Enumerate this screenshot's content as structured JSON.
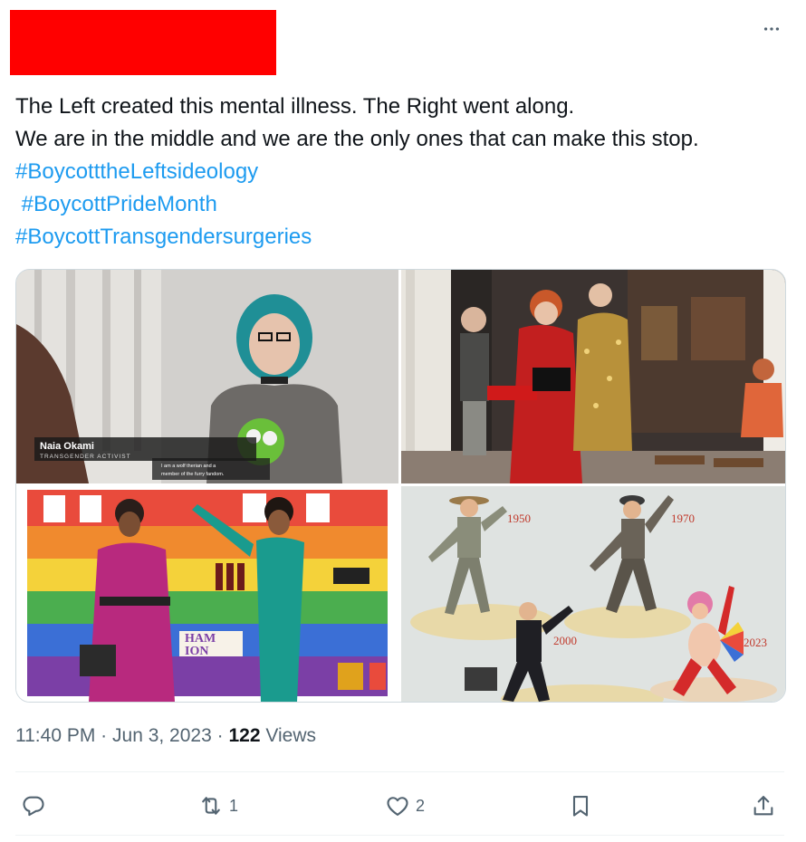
{
  "header": {
    "redaction_color": "#ff0000",
    "more_icon": "more-horizontal-icon"
  },
  "tweet": {
    "lines": [
      "The Left created this mental illness. The Right went along.",
      "We are in the middle and we are the only ones that can make this stop."
    ],
    "hashtags": [
      "#BoycotttheLeftsideology",
      " #BoycottPrideMonth",
      "#BoycottTransgendersurgeries"
    ],
    "link_color": "#1d9bf0"
  },
  "media": {
    "image1": {
      "name_label": "Naia Okami",
      "title_label": "TRANSGENDER ACTIVIST",
      "caption_line1": "I am a wolf therian and a",
      "caption_line2": "member of the furry fandom."
    },
    "image3": {
      "sign_text1": "HAM",
      "sign_text2": "ION"
    },
    "image4": {
      "year1": "1950",
      "year2": "1970",
      "year3": "2000",
      "year4": "2023"
    }
  },
  "meta": {
    "time": "11:40 PM",
    "date": "Jun 3, 2023",
    "dot": "·",
    "views_count": "122",
    "views_label": "Views"
  },
  "actions": {
    "reply": {
      "icon": "reply-icon",
      "count": ""
    },
    "retweet": {
      "icon": "retweet-icon",
      "count": "1"
    },
    "like": {
      "icon": "heart-icon",
      "count": "2"
    },
    "bookmark": {
      "icon": "bookmark-icon"
    },
    "share": {
      "icon": "share-icon"
    }
  }
}
